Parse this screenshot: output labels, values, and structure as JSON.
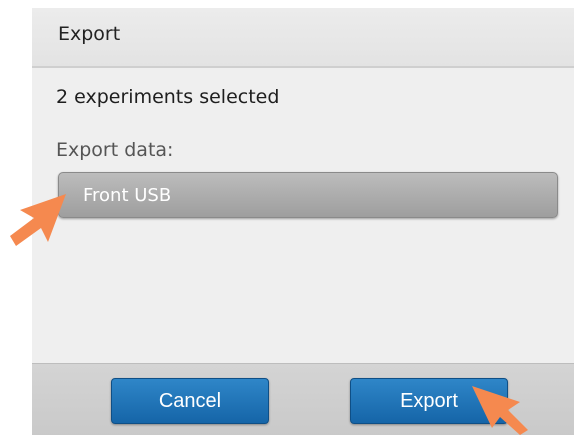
{
  "dialog": {
    "title": "Export",
    "selected_count_text": "2 experiments selected",
    "export_data_label": "Export data:",
    "destination": {
      "value": "Front USB"
    }
  },
  "footer": {
    "cancel_label": "Cancel",
    "export_label": "Export"
  },
  "annotations": {
    "arrow_color": "#f5894f",
    "arrows": [
      "pointer-arrow-icon",
      "pointer-arrow-icon"
    ]
  },
  "colors": {
    "button_blue": "#1f74b8",
    "select_gray": "#a8a8a8",
    "background": "#efefef"
  }
}
